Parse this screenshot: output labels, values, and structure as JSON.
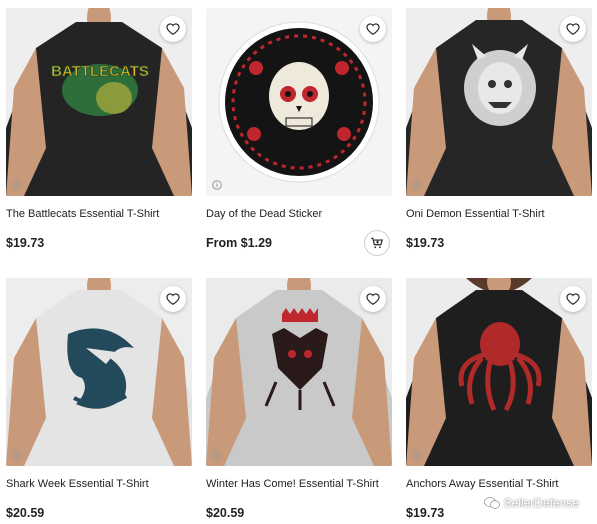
{
  "products": [
    {
      "title": "The Battlecats Essential T-Shirt",
      "price": "$19.73",
      "image": "battlecats-shirt"
    },
    {
      "title": "Day of the Dead Sticker",
      "price": "From $1.29",
      "image": "sugar-skull-sticker"
    },
    {
      "title": "Oni Demon Essential T-Shirt",
      "price": "$19.73",
      "image": "oni-demon-shirt"
    },
    {
      "title": "Shark Week Essential T-Shirt",
      "price": "$20.59",
      "image": "shark-week-shirt"
    },
    {
      "title": "Winter Has Come! Essential T-Shirt",
      "price": "$20.59",
      "image": "winter-has-come-shirt"
    },
    {
      "title": "Anchors Away Essential T-Shirt",
      "price": "$19.73",
      "image": "anchors-away-shirt"
    }
  ],
  "watermark": {
    "text": "SellerDefense"
  },
  "logo_text": {
    "battlecats": "BATTLECATS"
  },
  "colors": {
    "accent_red": "#c0262d",
    "dark_shirt": "#222222",
    "light_shirt": "#e3e3e3"
  }
}
